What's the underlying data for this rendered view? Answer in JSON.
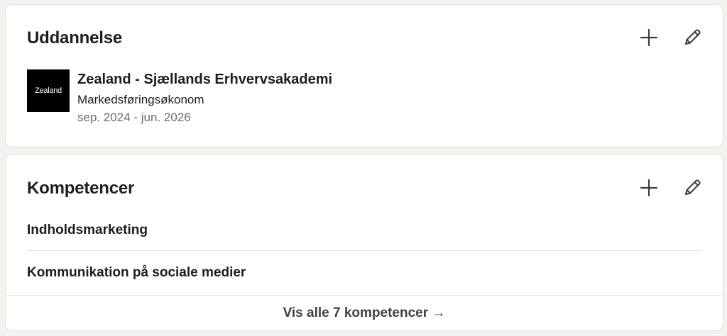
{
  "education": {
    "title": "Uddannelse",
    "add_icon": "plus-icon",
    "edit_icon": "pencil-icon",
    "entries": [
      {
        "logo_text": "Zealand",
        "school": "Zealand - Sjællands Erhvervsakademi",
        "degree": "Markedsføringsøkonom",
        "dates": "sep. 2024 - jun. 2026"
      }
    ]
  },
  "skills": {
    "title": "Kompetencer",
    "add_icon": "plus-icon",
    "edit_icon": "pencil-icon",
    "items": [
      "Indholdsmarketing",
      "Kommunikation på sociale medier"
    ],
    "show_all_label": "Vis alle 7 kompetencer →"
  },
  "colors": {
    "background": "#f4f2ee",
    "card": "#ffffff",
    "text": "#1d1d1d",
    "muted": "#6b6b6b",
    "logo_bg": "#000000"
  }
}
